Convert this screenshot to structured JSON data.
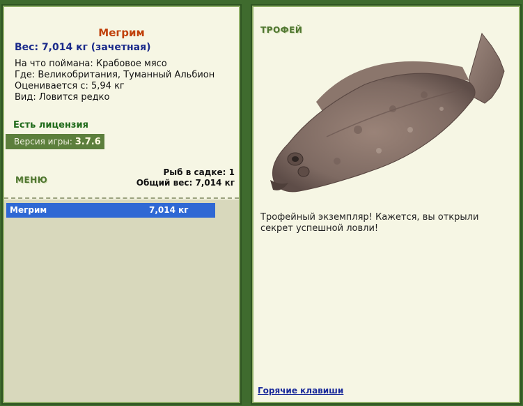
{
  "fish": {
    "name": "Мегрим",
    "weight_line": "Вес: 7,014 кг (зачетная)",
    "bait": "На что поймана: Крабовое мясо",
    "location": "Где: Великобритания, Туманный Альбион",
    "valued_from": "Оценивается с: 5,94 кг",
    "kind": "Вид: Ловится редко"
  },
  "license": "Есть лицензия",
  "version": {
    "label": "Версия игры:",
    "value": "3.7.6"
  },
  "menu_label": "МЕНЮ",
  "keepnet": {
    "count_line": "Рыб в садке: 1",
    "total_line": "Общий вес: 7,014 кг"
  },
  "catch_list": [
    {
      "name": "Мегрим",
      "weight": "7,014 кг"
    }
  ],
  "trophy": {
    "title": "ТРОФЕЙ",
    "text": "Трофейный экземпляр! Кажется, вы открыли секрет успешной ловли!",
    "image_icon": "megrim-fish-image"
  },
  "hotkeys_label": "Горячие клавиши",
  "colors": {
    "background": "#3f6b2e",
    "panel": "#f6f6e4",
    "selected_row": "#2f68d4",
    "fish_name": "#c0400a",
    "weight": "#1a2a8a"
  }
}
